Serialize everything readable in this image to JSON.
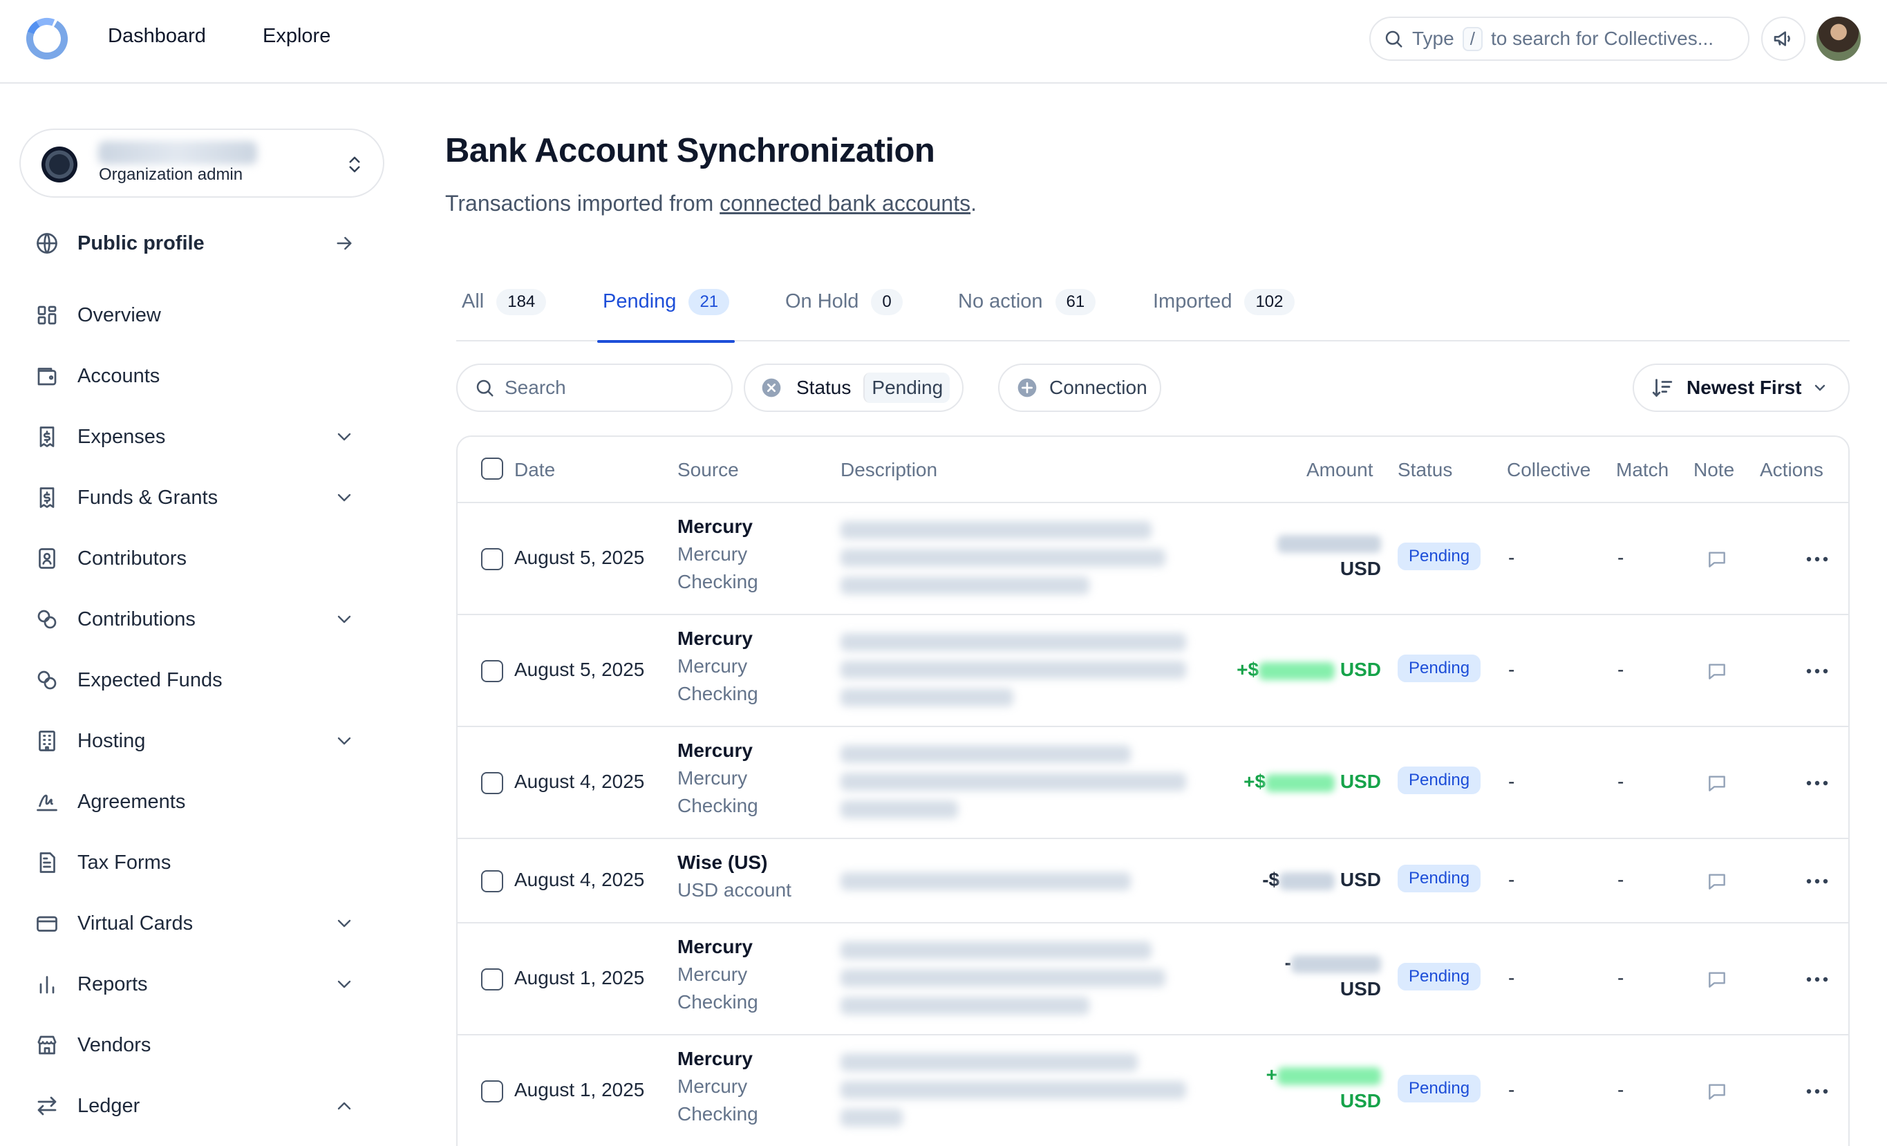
{
  "topbar": {
    "nav": [
      "Dashboard",
      "Explore"
    ],
    "search": {
      "prefix": "Type",
      "key": "/",
      "suffix": "to search for Collectives..."
    }
  },
  "sidebar": {
    "org_role": "Organization admin",
    "items": [
      {
        "label": "Public profile",
        "icon": "globe-icon",
        "trailing": "arrow-right-icon"
      },
      {
        "label": "Overview",
        "icon": "layout-grid-icon"
      },
      {
        "label": "Accounts",
        "icon": "wallet-icon"
      },
      {
        "label": "Expenses",
        "icon": "receipt-dollar-icon",
        "trailing": "chevron-down-icon"
      },
      {
        "label": "Funds & Grants",
        "icon": "receipt-dollar-icon",
        "trailing": "chevron-down-icon"
      },
      {
        "label": "Contributors",
        "icon": "contact-card-icon"
      },
      {
        "label": "Contributions",
        "icon": "coins-icon",
        "trailing": "chevron-down-icon"
      },
      {
        "label": "Expected Funds",
        "icon": "coins-icon"
      },
      {
        "label": "Hosting",
        "icon": "building-icon",
        "trailing": "chevron-down-icon"
      },
      {
        "label": "Agreements",
        "icon": "signature-icon"
      },
      {
        "label": "Tax Forms",
        "icon": "document-icon"
      },
      {
        "label": "Virtual Cards",
        "icon": "credit-card-icon",
        "trailing": "chevron-down-icon"
      },
      {
        "label": "Reports",
        "icon": "bar-chart-icon",
        "trailing": "chevron-down-icon"
      },
      {
        "label": "Vendors",
        "icon": "store-icon"
      },
      {
        "label": "Ledger",
        "icon": "arrows-left-right-icon",
        "trailing": "chevron-up-icon"
      }
    ]
  },
  "page": {
    "title": "Bank Account Synchronization",
    "subtitle_prefix": "Transactions imported from ",
    "subtitle_link": "connected bank accounts",
    "subtitle_suffix": "."
  },
  "tabs": [
    {
      "label": "All",
      "count": "184"
    },
    {
      "label": "Pending",
      "count": "21",
      "active": true
    },
    {
      "label": "On Hold",
      "count": "0"
    },
    {
      "label": "No action",
      "count": "61"
    },
    {
      "label": "Imported",
      "count": "102"
    }
  ],
  "filters": {
    "search_placeholder": "Search",
    "status_label": "Status",
    "status_value": "Pending",
    "connection_label": "Connection",
    "sort_label": "Newest First"
  },
  "table": {
    "headers": [
      "Date",
      "Source",
      "Description",
      "Amount",
      "Status",
      "Collective",
      "Match",
      "Note",
      "Actions"
    ],
    "rows": [
      {
        "date": "August 5, 2025",
        "source": "Mercury",
        "account_line1": "Mercury",
        "account_line2": "Checking",
        "amount_prefix": "",
        "currency": "USD",
        "status": "Pending",
        "collective": "-",
        "match": "-"
      },
      {
        "date": "August 5, 2025",
        "source": "Mercury",
        "account_line1": "Mercury",
        "account_line2": "Checking",
        "amount_prefix": "+$",
        "currency": "USD",
        "status": "Pending",
        "collective": "-",
        "match": "-"
      },
      {
        "date": "August 4, 2025",
        "source": "Mercury",
        "account_line1": "Mercury",
        "account_line2": "Checking",
        "amount_prefix": "+$",
        "currency": "USD",
        "status": "Pending",
        "collective": "-",
        "match": "-"
      },
      {
        "date": "August 4, 2025",
        "source": "Wise (US)",
        "account_line1": "USD account",
        "account_line2": "",
        "amount_prefix": "-$",
        "currency": "USD",
        "status": "Pending",
        "collective": "-",
        "match": "-"
      },
      {
        "date": "August 1, 2025",
        "source": "Mercury",
        "account_line1": "Mercury",
        "account_line2": "Checking",
        "amount_prefix": "-",
        "currency": "USD",
        "status": "Pending",
        "collective": "-",
        "match": "-"
      },
      {
        "date": "August 1, 2025",
        "source": "Mercury",
        "account_line1": "Mercury",
        "account_line2": "Checking",
        "amount_prefix": "+",
        "currency": "USD",
        "status": "Pending",
        "collective": "-",
        "match": "-"
      }
    ]
  },
  "colors": {
    "accent": "#1d4ed8",
    "positive": "#16a34a",
    "badge_bg": "#dbeafe",
    "border": "#e5e7eb"
  }
}
